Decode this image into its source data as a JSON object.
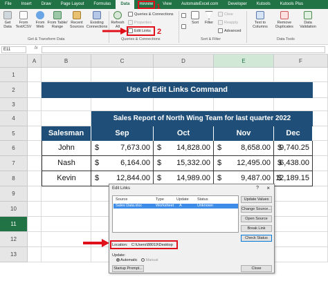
{
  "ribbon": {
    "tabs": [
      "File",
      "Insert",
      "Draw",
      "Page Layout",
      "Formulas",
      "Data",
      "Review",
      "View",
      "AutomateExcel.com",
      "Developer",
      "Kutools",
      "Kutools Plus"
    ],
    "active_tab": "Data",
    "buttons": {
      "get_data": "Get\nData",
      "from_text_csv": "From\nText/CSV",
      "from_web": "From\nWeb",
      "from_table_range": "From Table/\nRange",
      "recent_sources": "Recent\nSources",
      "existing_connections": "Existing\nConnections",
      "refresh_all": "Refresh\nAll",
      "queries_connections": "Queries & Connections",
      "properties": "Properties",
      "edit_links": "Edit Links",
      "sort": "Sort",
      "filter": "Filter",
      "clear": "Clear",
      "reapply": "Reapply",
      "advanced": "Advanced",
      "text_to_columns": "Text to\nColumns",
      "remove_duplicates": "Remove\nDuplicates",
      "data_validation": "Data\nValidation"
    },
    "groups": {
      "get_transform": "Get & Transform Data",
      "queries_connections": "Queries & Connections",
      "sort_filter": "Sort & Filter",
      "data_tools": "Data Tools"
    },
    "markers": {
      "one": "1",
      "two": "2"
    }
  },
  "formula_bar": {
    "name_box": "E11",
    "fx": "fx",
    "content": ""
  },
  "sheet": {
    "columns": [
      "A",
      "B",
      "C",
      "D",
      "E",
      "F"
    ],
    "selected_column": "E",
    "rows": [
      "1",
      "2",
      "3",
      "4",
      "5",
      "6",
      "7",
      "8",
      "9",
      "10",
      "11",
      "12",
      "13"
    ],
    "selected_row": "11",
    "title": "Use of Edit Links Command",
    "report_title": "Sales Report of North Wing Team for last quarter 2022",
    "headers": [
      "Salesman",
      "Sep",
      "Oct",
      "Nov",
      "Dec"
    ],
    "data": [
      {
        "name": "John",
        "values": [
          "7,673.00",
          "14,828.00",
          "8,658.00",
          "9,740.25"
        ]
      },
      {
        "name": "Nash",
        "values": [
          "6,164.00",
          "15,332.00",
          "12,495.00",
          "6,438.00"
        ]
      },
      {
        "name": "Kevin",
        "values": [
          "12,844.00",
          "14,989.00",
          "9,487.00",
          "12,189.15"
        ]
      }
    ],
    "currency": "$"
  },
  "dialog": {
    "title": "Edit Links",
    "help": "?",
    "close": "×",
    "list_headers": [
      "Source",
      "Type",
      "Update",
      "Status"
    ],
    "row": {
      "source": "Sales Data.xlsx",
      "type": "Worksheet",
      "update": "A",
      "status": "Unknown"
    },
    "buttons": [
      "Update Values",
      "Change Source...",
      "Open Source",
      "Break Link",
      "Check Status"
    ],
    "location_label": "Location:",
    "location_value": "C:\\Users\\88019\\Desktop",
    "update_label": "Update:",
    "auto_label": "Automatic",
    "manual_label": "Manual",
    "startup_prompt": "Startup Prompt...",
    "close_button": "Close"
  },
  "colors": {
    "excel_green": "#217346",
    "table_blue": "#1f4e79",
    "highlight_red": "#e0101b",
    "list_select": "#3d8ce8"
  }
}
